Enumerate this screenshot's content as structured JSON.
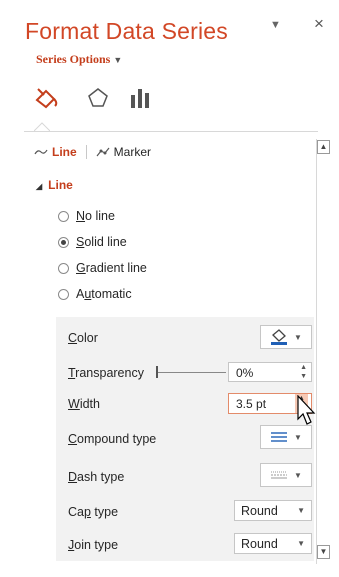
{
  "panel": {
    "title": "Format Data Series",
    "pin_icon": "▼",
    "close_icon": "×",
    "series_options": "Series Options",
    "series_options_arrow": "▼"
  },
  "tabs": {
    "line": "Line",
    "marker": "Marker"
  },
  "section": {
    "title": "Line",
    "toggle": "◢"
  },
  "radios": [
    {
      "label": "No line",
      "key": "N",
      "rest": "o line",
      "selected": false
    },
    {
      "label": "Solid line",
      "key": "S",
      "rest": "olid line",
      "selected": true
    },
    {
      "label": "Gradient line",
      "key": "G",
      "rest": "radient line",
      "selected": false
    },
    {
      "label": "Automatic",
      "pre": "A",
      "key": "u",
      "rest": "tomatic",
      "selected": false
    }
  ],
  "props": {
    "color": {
      "key": "C",
      "rest": "olor"
    },
    "transparency": {
      "key": "T",
      "rest": "ransparency",
      "value": "0%"
    },
    "width": {
      "key": "W",
      "rest": "idth",
      "value": "3.5 pt"
    },
    "compound": {
      "key": "C",
      "rest": "ompound type"
    },
    "dash": {
      "key": "D",
      "rest": "ash type"
    },
    "cap": {
      "pre": "Ca",
      "key": "p",
      "rest": " type",
      "value": "Round"
    },
    "join": {
      "key": "J",
      "rest": "oin type",
      "value": "Round"
    }
  },
  "colors": {
    "accent": "#d24726",
    "fill_icon": "#1f5fb5"
  }
}
